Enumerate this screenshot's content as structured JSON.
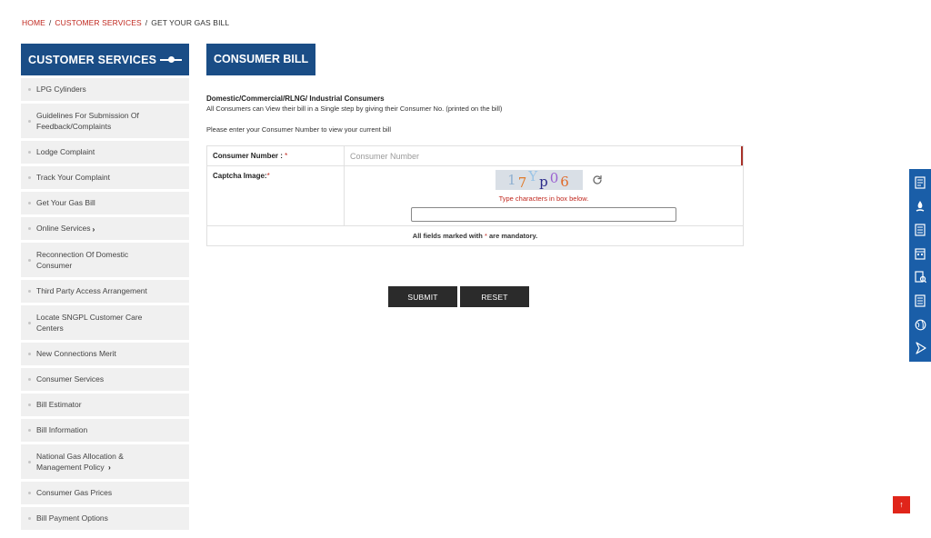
{
  "breadcrumb": {
    "home": "HOME",
    "section": "CUSTOMER SERVICES",
    "current": "GET YOUR GAS BILL",
    "sep": "/"
  },
  "sidebar": {
    "title": "CUSTOMER SERVICES",
    "items": [
      {
        "label": "LPG Cylinders"
      },
      {
        "label": "Guidelines For Submission Of Feedback/Complaints"
      },
      {
        "label": "Lodge Complaint"
      },
      {
        "label": "Track Your Complaint"
      },
      {
        "label": "Get Your Gas Bill"
      },
      {
        "label": "Online Services",
        "chevron": "›"
      },
      {
        "label": "Reconnection Of Domestic Consumer"
      },
      {
        "label": "Third Party Access Arrangement"
      },
      {
        "label": "Locate SNGPL Customer Care Centers"
      },
      {
        "label": "New Connections Merit"
      },
      {
        "label": "Consumer Services"
      },
      {
        "label": "Bill Estimator"
      },
      {
        "label": "Bill Information"
      },
      {
        "label": "National Gas Allocation & Management Policy",
        "chevron": "›"
      },
      {
        "label": "Consumer Gas Prices"
      },
      {
        "label": "Bill Payment Options"
      }
    ]
  },
  "main": {
    "title": "CONSUMER BILL",
    "subhead": "Domestic/Commercial/RLNG/ Industrial Consumers",
    "desc": "All Consumers can View their bill in a Single step by giving their Consumer No. (printed on the bill)",
    "prompt": "Please enter your Consumer Number to view your current bill",
    "form": {
      "consumer_label": "Consumer Number :",
      "consumer_placeholder": "Consumer Number",
      "captcha_label": "Captcha Image:",
      "captcha_text": "17Yp06",
      "captcha_hint": "Type characters in box below.",
      "mandatory_note_pre": "All fields marked with",
      "mandatory_note_post": "are mandatory.",
      "required_mark": "*"
    },
    "buttons": {
      "submit": "SUBMIT",
      "reset": "RESET"
    }
  },
  "right_bar_icons": [
    "bill-icon",
    "gas-flame-icon",
    "document-icon",
    "calendar-icon",
    "search-document-icon",
    "list-icon",
    "globe-icon",
    "play-icon"
  ],
  "scroll_top": "↑",
  "colors": {
    "brand_blue": "#1a4d86",
    "accent_red": "#c0281f",
    "button_dark": "#2b2b2b",
    "right_bar": "#1a5ea8"
  }
}
